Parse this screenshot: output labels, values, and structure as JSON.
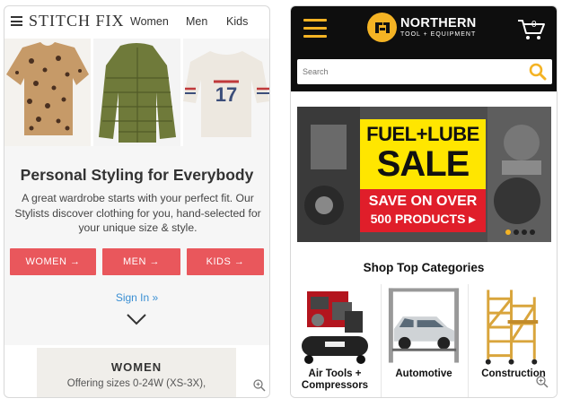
{
  "stitchfix": {
    "logo": "STITCH FIX",
    "nav": [
      "Women",
      "Men",
      "Kids"
    ],
    "hero_title": "Personal Styling for Everybody",
    "hero_text": "A great wardrobe starts with your perfect fit. Our Stylists discover clothing for you, hand-selected for your unique size & style.",
    "buttons": {
      "women": "WOMEN →",
      "men": "MEN →",
      "kids": "KIDS →"
    },
    "sign_in": "Sign In »",
    "women_card": {
      "title": "WOMEN",
      "subtitle": "Offering sizes 0-24W (XS-3X),"
    },
    "product_numbers": "17",
    "accent_color": "#e9575c",
    "link_color": "#3a8fd3"
  },
  "northern": {
    "logo_title": "NORTHERN",
    "logo_subtitle": "TOOL + EQUIPMENT",
    "cart_count": "0",
    "search_placeholder": "Search",
    "banner": {
      "line1": "FUEL+LUBE",
      "line2": "SALE",
      "line3": "SAVE ON OVER",
      "line4": "500 PRODUCTS ▸"
    },
    "section_title": "Shop Top Categories",
    "categories": [
      {
        "label": "Air Tools + Compressors"
      },
      {
        "label": "Automotive"
      },
      {
        "label": "Construction"
      }
    ],
    "brand_color": "#f4b324",
    "sale_yellow": "#ffe600",
    "sale_red": "#e01e2a"
  }
}
